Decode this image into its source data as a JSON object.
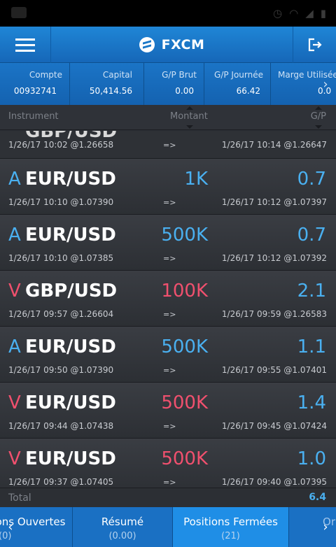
{
  "app": {
    "title": "FXCM"
  },
  "summary": [
    {
      "label": "Compte",
      "value": "00932741"
    },
    {
      "label": "Capital",
      "value": "50,414.56"
    },
    {
      "label": "G/P Brut",
      "value": "0.00"
    },
    {
      "label": "G/P Journée",
      "value": "66.42"
    },
    {
      "label": "Marge Utilisée",
      "value": "0.0"
    }
  ],
  "columns": {
    "instrument": "Instrument",
    "amount": "Montant",
    "pl": "G/P"
  },
  "partial_row": {
    "symbol": "GBP/USD",
    "open": "1/26/17 10:02 @1.26658",
    "arrow": "=>",
    "close": "1/26/17 10:14 @1.26647"
  },
  "rows": [
    {
      "side": "A",
      "symbol": "EUR/USD",
      "amount": "1K",
      "pl": "0.7",
      "open": "1/26/17 10:10 @1.07390",
      "arrow": "=>",
      "close": "1/26/17 10:12 @1.07397"
    },
    {
      "side": "A",
      "symbol": "EUR/USD",
      "amount": "500K",
      "pl": "0.7",
      "open": "1/26/17 10:10 @1.07385",
      "arrow": "=>",
      "close": "1/26/17 10:12 @1.07392"
    },
    {
      "side": "V",
      "symbol": "GBP/USD",
      "amount": "100K",
      "pl": "2.1",
      "open": "1/26/17 09:57 @1.26604",
      "arrow": "=>",
      "close": "1/26/17 09:59 @1.26583"
    },
    {
      "side": "A",
      "symbol": "EUR/USD",
      "amount": "500K",
      "pl": "1.1",
      "open": "1/26/17 09:50 @1.07390",
      "arrow": "=>",
      "close": "1/26/17 09:55 @1.07401"
    },
    {
      "side": "V",
      "symbol": "EUR/USD",
      "amount": "500K",
      "pl": "1.4",
      "open": "1/26/17 09:44 @1.07438",
      "arrow": "=>",
      "close": "1/26/17 09:45 @1.07424"
    },
    {
      "side": "V",
      "symbol": "EUR/USD",
      "amount": "500K",
      "pl": "1.0",
      "open": "1/26/17 09:37 @1.07405",
      "arrow": "=>",
      "close": "1/26/17 09:40 @1.07395"
    }
  ],
  "total": {
    "label": "Total",
    "value": "6.4"
  },
  "tabs": [
    {
      "name": "ons Ouvertes",
      "count": "(0)"
    },
    {
      "name": "Résumé",
      "count": "(0.00)"
    },
    {
      "name": "Positions Fermées",
      "count": "(21)"
    },
    {
      "name": "Or",
      "count": ""
    }
  ],
  "colors": {
    "buy": "#4ab0f0",
    "sell": "#f0506e",
    "accent": "#1a70c3"
  }
}
